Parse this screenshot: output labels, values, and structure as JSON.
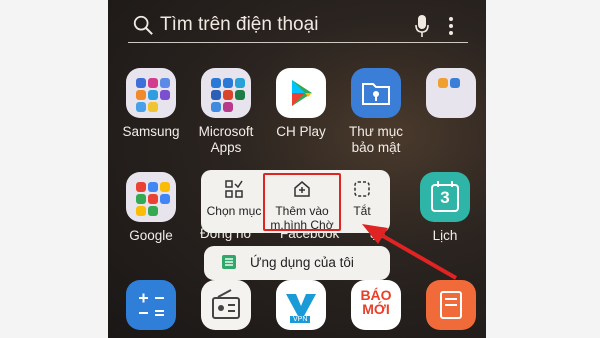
{
  "search": {
    "placeholder": "Tìm trên điện thoại"
  },
  "apps": {
    "samsung": "Samsung",
    "microsoft": "Microsoft\nApps",
    "chplay": "CH Play",
    "secure_folder": "Thư mục\nbảo mật",
    "google": "Google",
    "calendar": "Lịch",
    "baomoi_text": "BÁO\nMỚI",
    "vpn_text": "VPN",
    "calendar_day": "3",
    "partial_1": "Đồng hồ",
    "partial_2": "Facebook",
    "partial_3": "ập"
  },
  "popup": {
    "select": "Chọn mục",
    "add_home": "Thêm vào\nm.hình Chờ",
    "off": "Tắt",
    "app_info": "Ứng dụng của tôi"
  },
  "colors": {
    "highlight": "#e02323",
    "popup_bg": "#f3f1ee"
  }
}
